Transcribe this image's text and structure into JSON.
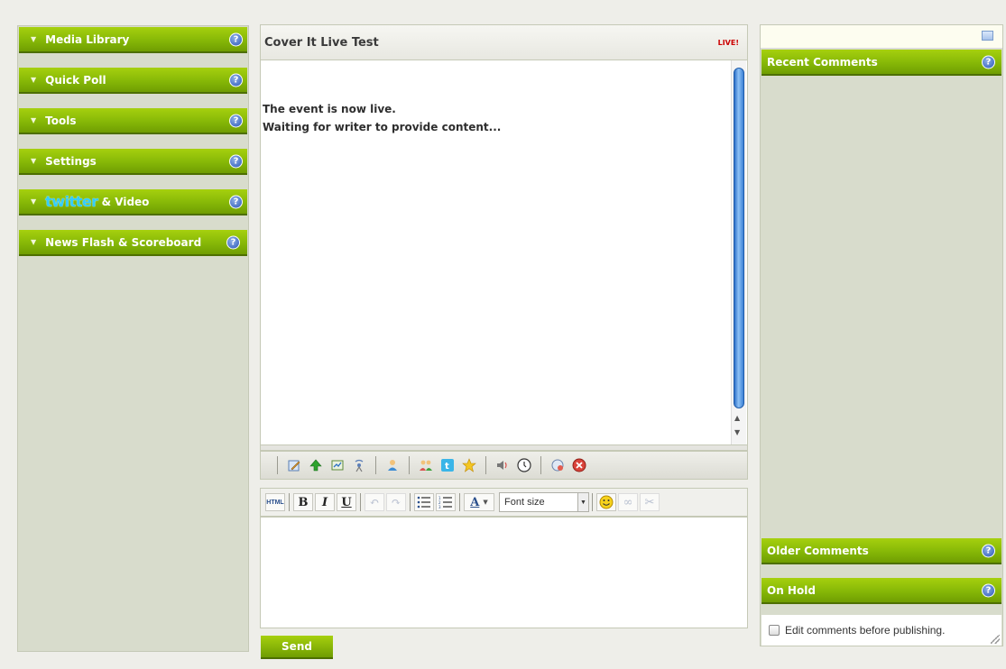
{
  "left_panel": {
    "sections": [
      {
        "label": "Media Library"
      },
      {
        "label": "Quick Poll"
      },
      {
        "label": "Tools"
      },
      {
        "label": "Settings"
      },
      {
        "label": "& Video",
        "logo": "twitter"
      },
      {
        "label": "News Flash & Scoreboard"
      }
    ],
    "help_glyph": "?"
  },
  "center": {
    "title": "Cover It Live Test",
    "live_badge": "LIVE!",
    "content_lines": [
      "The event is now live.",
      "Waiting for writer to provide content..."
    ],
    "editor": {
      "html_label": "HTML",
      "bold": "B",
      "italic": "I",
      "underline": "U",
      "font_size_placeholder": "Font size"
    },
    "send_label": "Send"
  },
  "right_panel": {
    "recent_comments": "Recent Comments",
    "older_comments": "Older Comments",
    "on_hold": "On Hold",
    "edit_before_publishing": "Edit comments before publishing."
  },
  "colors": {
    "accent_green": "#86b807",
    "panel_bg": "#d8dccc",
    "live_red": "#cc0000"
  }
}
